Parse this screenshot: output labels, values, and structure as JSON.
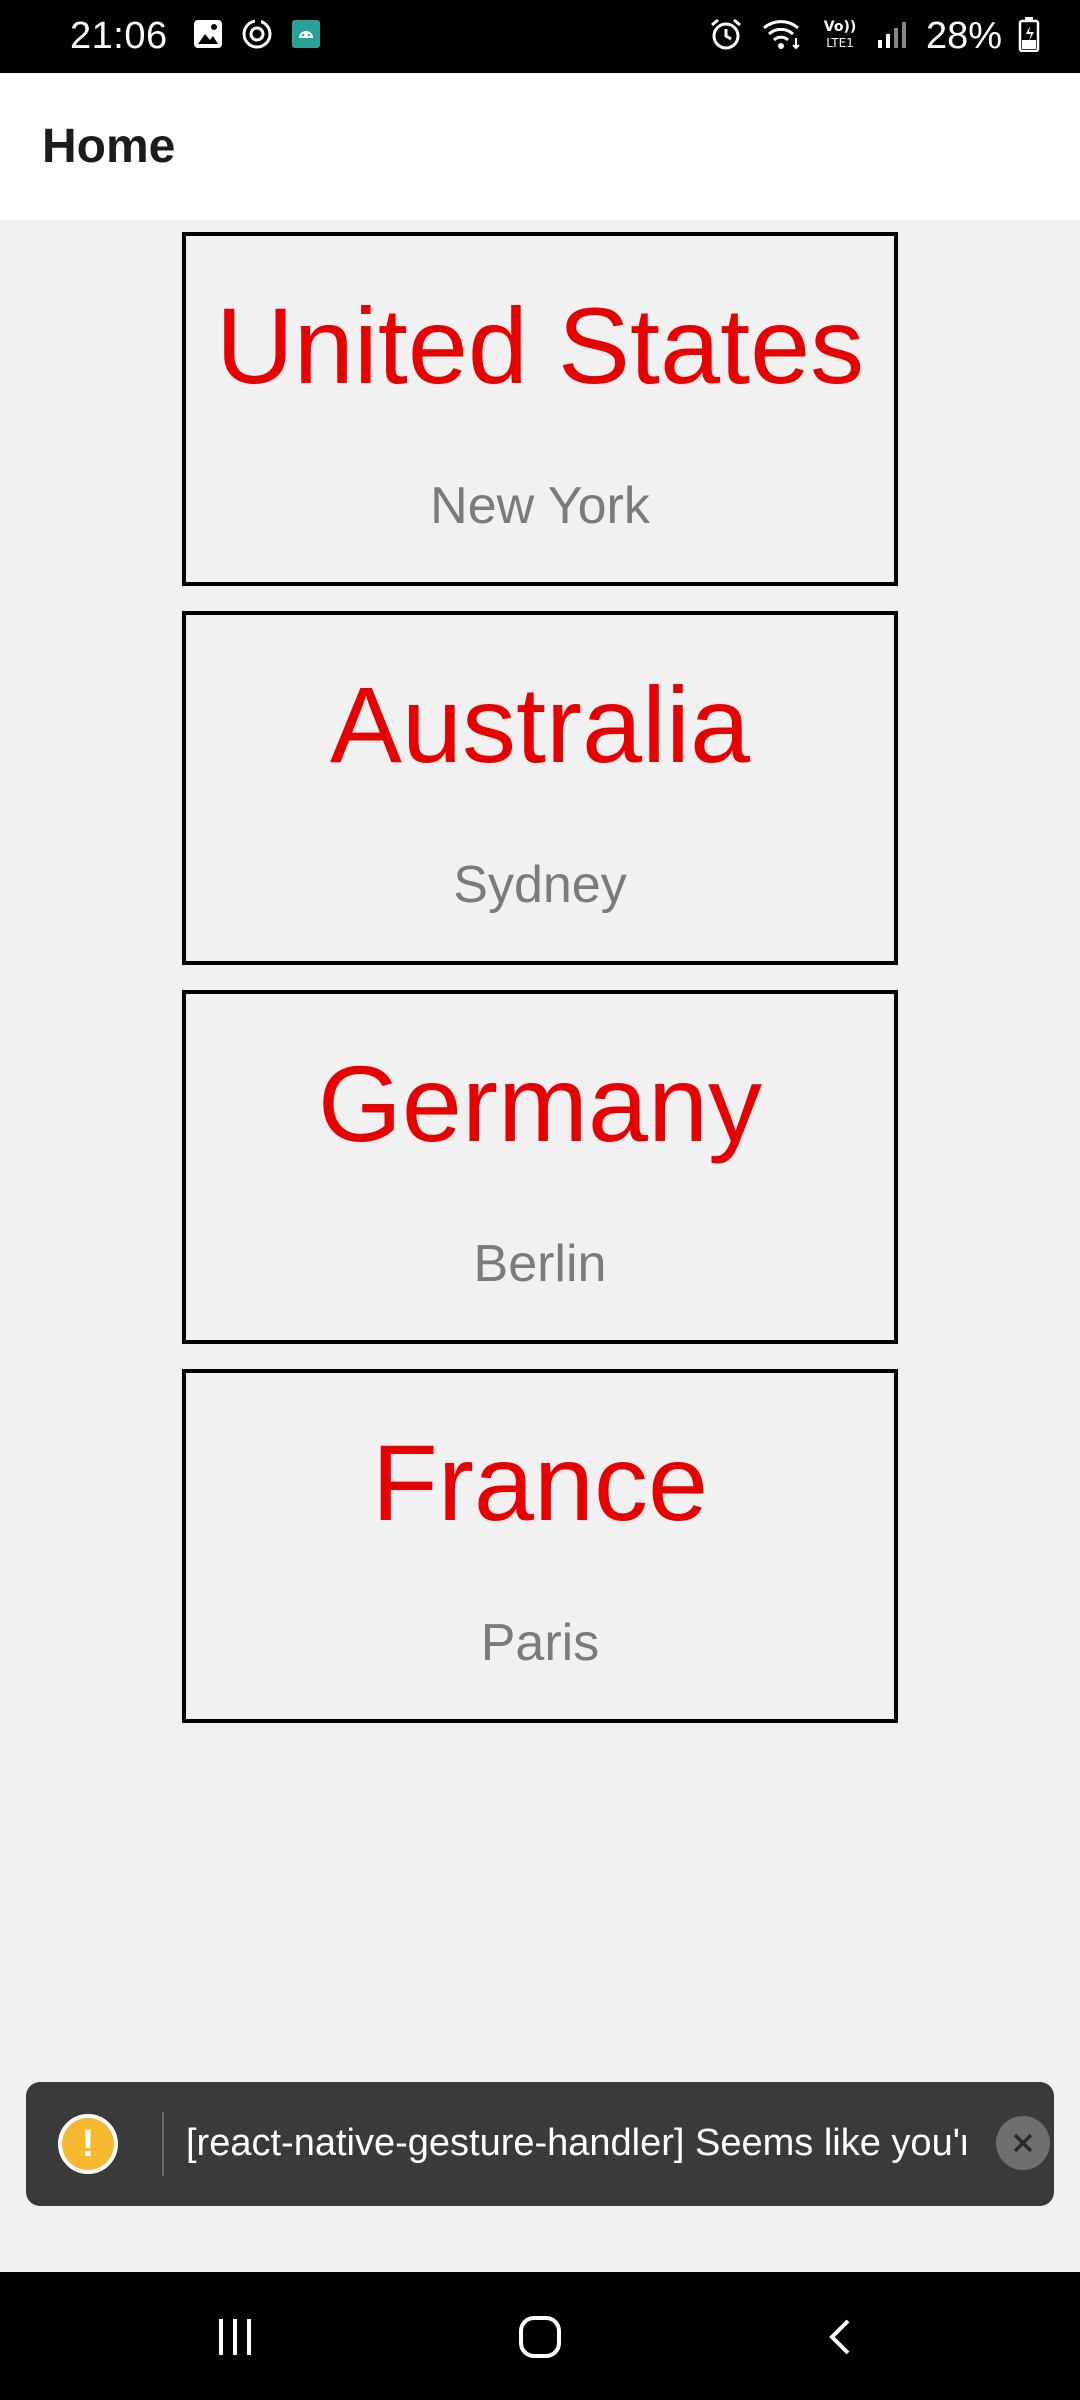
{
  "status_bar": {
    "time": "21:06",
    "battery": "28%",
    "left_icons": [
      "image-icon",
      "sync-icon",
      "android-icon"
    ],
    "right_icons": [
      "alarm-icon",
      "wifi-icon",
      "volte-icon",
      "signal-icon",
      "battery-icon"
    ],
    "volte_label": "Vo))\nLTE1"
  },
  "app_bar": {
    "title": "Home"
  },
  "cards": [
    {
      "country": "United States",
      "city": "New York"
    },
    {
      "country": "Australia",
      "city": "Sydney"
    },
    {
      "country": "Germany",
      "city": "Berlin"
    },
    {
      "country": "France",
      "city": "Paris"
    }
  ],
  "toast": {
    "icon_glyph": "!",
    "message": "[react-native-gesture-handler] Seems like you'r...",
    "close_icon": "close-icon",
    "accent": "#f5b82e"
  },
  "colors": {
    "country_text": "#e60000",
    "city_text": "#7b7b7b",
    "background": "#f1f1f1"
  },
  "nav_bar": {
    "buttons": [
      "recents-button",
      "home-button",
      "back-button"
    ]
  }
}
